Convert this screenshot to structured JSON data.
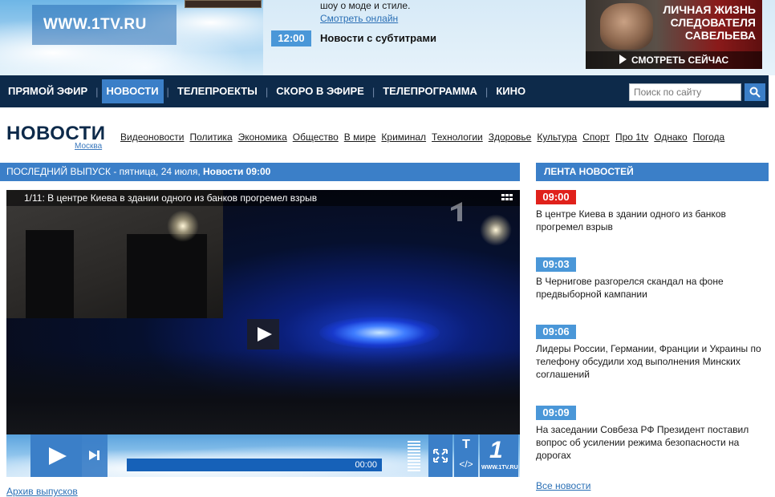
{
  "header": {
    "site_logo": "WWW.1TV.RU",
    "promo_desc": "шоу о моде и стиле.",
    "watch_online": "Смотреть онлайн",
    "time": "12:00",
    "program_title": "Новости с субтитрами",
    "ad": {
      "title": "Личная жизнь следователя Савельева",
      "watch": "СМОТРЕТЬ СЕЙЧАС"
    }
  },
  "nav": {
    "items": [
      "ПРЯМОЙ ЭФИР",
      "НОВОСТИ",
      "ТЕЛЕПРОЕКТЫ",
      "СКОРО В ЭФИРЕ",
      "ТЕЛЕПРОГРАММА",
      "КИНО"
    ],
    "active_index": 1,
    "search_placeholder": "Поиск по сайту"
  },
  "section": {
    "title": "НОВОСТИ",
    "region": "Москва",
    "categories": [
      "Видеоновости",
      "Политика",
      "Экономика",
      "Общество",
      "В мире",
      "Криминал",
      "Технологии",
      "Здоровье",
      "Культура",
      "Спорт",
      "Про 1tv",
      "Однако",
      "Погода"
    ]
  },
  "latest": {
    "label": "ПОСЛЕДНИЙ ВЫПУСК",
    "date": " - пятница, 24 июля, ",
    "edition": "Новости 09:00"
  },
  "player": {
    "caption": "1/11: В центре Киева в здании одного из банков прогремел взрыв",
    "time": "00:00",
    "sub_t": "T",
    "sub_embed": "</>",
    "logo_num": "1",
    "logo_site": "WWW.1TV.RU"
  },
  "archive_link": "Архив выпусков",
  "feed": {
    "title": "ЛЕНТА НОВОСТЕЙ",
    "items": [
      {
        "time": "09:00",
        "hot": true,
        "text": "В центре Киева в здании одного из банков прогремел взрыв"
      },
      {
        "time": "09:03",
        "hot": false,
        "text": "В Чернигове разгорелся скандал на фоне предвыборной кампании"
      },
      {
        "time": "09:06",
        "hot": false,
        "text": "Лидеры России, Германии, Франции и Украины по телефону обсудили ход выполнения Минских соглашений"
      },
      {
        "time": "09:09",
        "hot": false,
        "text": "На заседании Совбеза РФ Президент поставил вопрос об усилении режима безопасности на дорогах"
      }
    ],
    "all_news": "Все новости"
  },
  "colors": {
    "nav_bg": "#0d2a4a",
    "accent": "#3b7fc8",
    "badge": "#4a97d8",
    "hot": "#e0211b"
  }
}
